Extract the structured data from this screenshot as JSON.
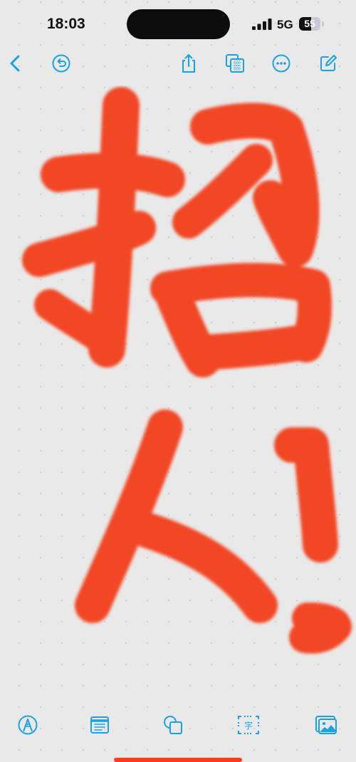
{
  "status_bar": {
    "time": "18:03",
    "network": "5G",
    "battery_level": "55",
    "battery_fraction": 0.55,
    "signal_bars": 4
  },
  "toolbar": {
    "left": [
      {
        "name": "back-button",
        "icon": "chevron-left-icon"
      },
      {
        "name": "undo-button",
        "icon": "undo-icon"
      }
    ],
    "right": [
      {
        "name": "share-button",
        "icon": "share-icon"
      },
      {
        "name": "grid-view-button",
        "icon": "grid-copy-icon"
      },
      {
        "name": "more-button",
        "icon": "ellipsis-icon"
      },
      {
        "name": "compose-button",
        "icon": "compose-icon"
      }
    ]
  },
  "canvas": {
    "handwritten_text": "招人!",
    "stroke_color": "#f23a12",
    "grid": "dotted"
  },
  "bottom_bar": {
    "items": [
      {
        "name": "pen-tool-button",
        "icon": "pen-icon"
      },
      {
        "name": "sticky-note-button",
        "icon": "note-icon"
      },
      {
        "name": "shapes-button",
        "icon": "shapes-icon"
      },
      {
        "name": "text-box-button",
        "icon": "text-box-icon",
        "glyph": "字"
      },
      {
        "name": "media-button",
        "icon": "photo-icon"
      }
    ]
  },
  "colors": {
    "accent": "#1aa1e6",
    "background": "#e9e9e9",
    "ink": "#f23a12",
    "home_indicator": "#ff3b1f"
  }
}
